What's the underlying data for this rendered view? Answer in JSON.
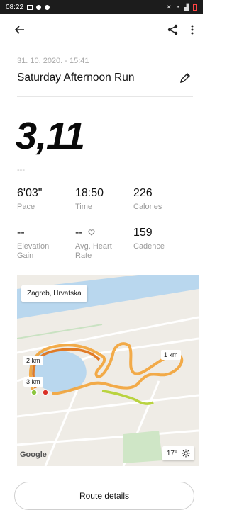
{
  "status_bar": {
    "time": "08:22"
  },
  "activity": {
    "datetime": "31. 10. 2020. - 15:41",
    "title": "Saturday Afternoon Run",
    "distance": "3,11",
    "distance_unit": "---"
  },
  "stats": [
    {
      "value": "6'03\"",
      "label": "Pace"
    },
    {
      "value": "18:50",
      "label": "Time"
    },
    {
      "value": "226",
      "label": "Calories"
    },
    {
      "value": "--",
      "label": "Elevation Gain"
    },
    {
      "value": "--",
      "label": "Avg. Heart Rate"
    },
    {
      "value": "159",
      "label": "Cadence"
    }
  ],
  "map": {
    "location": "Zagreb, Hrvatska",
    "markers": {
      "km1": "1 km",
      "km2": "2 km",
      "km3": "3 km"
    },
    "attribution": "Google",
    "weather_temp": "17°"
  },
  "route_button": "Route details",
  "colors": {
    "accent": "#e8842a",
    "route_start": "#a6d43a",
    "route_end": "#d93025"
  }
}
